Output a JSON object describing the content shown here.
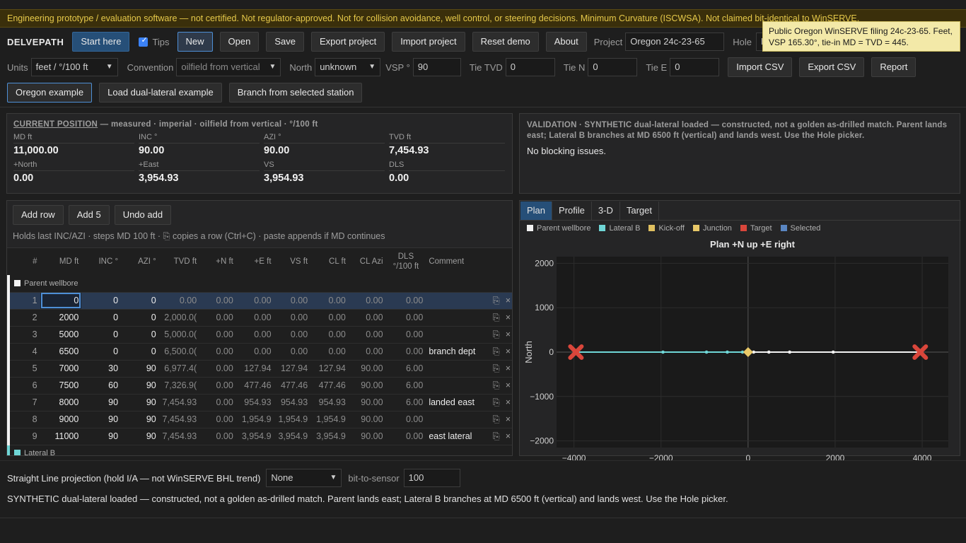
{
  "banner": "Engineering prototype / evaluation software — not certified. Not regulator-approved. Not for collision avoidance, well control, or steering decisions. Minimum Curvature (ISCWSA). Not claimed bit-identical to WinSERVE.",
  "toolbar": {
    "brand": "DELVEPATH",
    "start_here": "Start here",
    "tips_label": "Tips",
    "tips_checked": true,
    "new": "New",
    "open": "Open",
    "save": "Save",
    "export_project": "Export project",
    "import_project": "Import project",
    "reset_demo": "Reset demo",
    "about": "About",
    "project_label": "Project",
    "project_value": "Oregon 24c-23-65",
    "hole_label": "Hole",
    "hole_value": "Pa"
  },
  "tooltip": "Public Oregon WinSERVE filing 24c-23-65. Feet, VSP 165.30°, tie-in MD = TVD = 445.",
  "settings": {
    "units_label": "Units",
    "units_value": "feet / °/100 ft",
    "convention_label": "Convention",
    "convention_value": "oilfield from vertical",
    "north_label": "North",
    "north_value": "unknown",
    "vsp_label": "VSP °",
    "vsp_value": "90",
    "tie_tvd_label": "Tie TVD",
    "tie_tvd_value": "0",
    "tie_n_label": "Tie N",
    "tie_n_value": "0",
    "tie_e_label": "Tie E",
    "tie_e_value": "0",
    "import_csv": "Import CSV",
    "export_csv": "Export CSV",
    "report": "Report"
  },
  "examples": {
    "oregon": "Oregon example",
    "dual_lateral": "Load dual-lateral example",
    "branch": "Branch from selected station"
  },
  "position": {
    "title": "CURRENT POSITION",
    "subtitle": " — measured · imperial · oilfield from vertical · °/100 ft",
    "md_label": "MD ft",
    "md": "11,000.00",
    "inc_label": "INC °",
    "inc": "90.00",
    "azi_label": "AZI °",
    "azi": "90.00",
    "tvd_label": "TVD ft",
    "tvd": "7,454.93",
    "north_label": "+North",
    "north": "0.00",
    "east_label": "+East",
    "east": "3,954.93",
    "vs_label": "VS",
    "vs": "3,954.93",
    "dls_label": "DLS",
    "dls": "0.00"
  },
  "validation": {
    "title": "VALIDATION · SYNTHETIC dual-lateral loaded — constructed, not a golden as-drilled match. Parent lands east; Lateral B branches at MD 6500 ft (vertical) and lands west. Use the Hole picker.",
    "message": "No blocking issues."
  },
  "table_toolbar": {
    "add_row": "Add row",
    "add5": "Add 5",
    "undo_add": "Undo add"
  },
  "hint": "Holds last INC/AZI · steps MD 100 ft · ⎘ copies a row (Ctrl+C) · paste appends if MD continues",
  "columns": [
    "#",
    "MD ft",
    "INC °",
    "AZI °",
    "TVD ft",
    "+N ft",
    "+E ft",
    "VS ft",
    "CL ft",
    "CL Azi",
    "DLS °/100 ft",
    "Comment"
  ],
  "group_parent": "Parent wellbore",
  "group_lateral": "Lateral B",
  "rows": [
    {
      "n": "1",
      "md": "0",
      "inc": "0",
      "azi": "0",
      "tvd": "0.00",
      "north": "0.00",
      "east": "0.00",
      "vs": "0.00",
      "cl": "0.00",
      "clazi": "0.00",
      "dls": "0.00",
      "comment": ""
    },
    {
      "n": "2",
      "md": "2000",
      "inc": "0",
      "azi": "0",
      "tvd": "2,000.0(",
      "north": "0.00",
      "east": "0.00",
      "vs": "0.00",
      "cl": "0.00",
      "clazi": "0.00",
      "dls": "0.00",
      "comment": ""
    },
    {
      "n": "3",
      "md": "5000",
      "inc": "0",
      "azi": "0",
      "tvd": "5,000.0(",
      "north": "0.00",
      "east": "0.00",
      "vs": "0.00",
      "cl": "0.00",
      "clazi": "0.00",
      "dls": "0.00",
      "comment": ""
    },
    {
      "n": "4",
      "md": "6500",
      "inc": "0",
      "azi": "0",
      "tvd": "6,500.0(",
      "north": "0.00",
      "east": "0.00",
      "vs": "0.00",
      "cl": "0.00",
      "clazi": "0.00",
      "dls": "0.00",
      "comment": "branch dept"
    },
    {
      "n": "5",
      "md": "7000",
      "inc": "30",
      "azi": "90",
      "tvd": "6,977.4(",
      "north": "0.00",
      "east": "127.94",
      "vs": "127.94",
      "cl": "127.94",
      "clazi": "90.00",
      "dls": "6.00",
      "comment": ""
    },
    {
      "n": "6",
      "md": "7500",
      "inc": "60",
      "azi": "90",
      "tvd": "7,326.9(",
      "north": "0.00",
      "east": "477.46",
      "vs": "477.46",
      "cl": "477.46",
      "clazi": "90.00",
      "dls": "6.00",
      "comment": ""
    },
    {
      "n": "7",
      "md": "8000",
      "inc": "90",
      "azi": "90",
      "tvd": "7,454.93",
      "north": "0.00",
      "east": "954.93",
      "vs": "954.93",
      "cl": "954.93",
      "clazi": "90.00",
      "dls": "6.00",
      "comment": "landed east"
    },
    {
      "n": "8",
      "md": "9000",
      "inc": "90",
      "azi": "90",
      "tvd": "7,454.93",
      "north": "0.00",
      "east": "1,954.9",
      "vs": "1,954.9",
      "cl": "1,954.9",
      "clazi": "90.00",
      "dls": "0.00",
      "comment": ""
    },
    {
      "n": "9",
      "md": "11000",
      "inc": "90",
      "azi": "90",
      "tvd": "7,454.93",
      "north": "0.00",
      "east": "3,954.9",
      "vs": "3,954.9",
      "cl": "3,954.9",
      "clazi": "90.00",
      "dls": "0.00",
      "comment": "east lateral"
    }
  ],
  "tabs": [
    "Plan",
    "Profile",
    "3-D",
    "Target"
  ],
  "legend": [
    {
      "label": "Parent wellbore",
      "color": "#f2f2f2"
    },
    {
      "label": "Lateral B",
      "color": "#6fd6d6"
    },
    {
      "label": "Kick-off",
      "color": "#e0c060"
    },
    {
      "label": "Junction",
      "color": "#e8c868"
    },
    {
      "label": "Target",
      "color": "#d9463b"
    },
    {
      "label": "Selected",
      "color": "#5a86c2"
    }
  ],
  "chart_data": {
    "type": "line",
    "title": "Plan  +N up  +E right",
    "xlabel": "East",
    "ylabel": "North",
    "xlim": [
      -4400,
      4600
    ],
    "ylim": [
      -2150,
      2150
    ],
    "xticks": [
      -4000,
      -2000,
      0,
      2000,
      4000
    ],
    "yticks": [
      -2000,
      -1000,
      0,
      1000,
      2000
    ],
    "series": [
      {
        "name": "Parent wellbore",
        "color": "#f2f2f2",
        "x": [
          0,
          127.94,
          477.46,
          954.93,
          1954.93,
          3954.93
        ],
        "y": [
          0,
          0,
          0,
          0,
          0,
          0
        ]
      },
      {
        "name": "Lateral B",
        "color": "#6fd6d6",
        "x": [
          0,
          -127.94,
          -477.46,
          -954.93,
          -1954.93,
          -3954.93
        ],
        "y": [
          0,
          0,
          0,
          0,
          0,
          0
        ]
      }
    ],
    "targets": [
      {
        "x": -3954.93,
        "y": 0
      },
      {
        "x": 3954.93,
        "y": 0
      }
    ],
    "junction": {
      "x": 0,
      "y": 0
    }
  },
  "projection": {
    "label": "Straight Line projection (hold I/A — not WinSERVE BHL trend)",
    "mode": "None",
    "bit_label": "bit-to-sensor",
    "bit_value": "100"
  },
  "status": "SYNTHETIC dual-lateral loaded — constructed, not a golden as-drilled match. Parent lands east; Lateral B branches at MD 6500 ft (vertical) and lands west. Use the Hole picker."
}
